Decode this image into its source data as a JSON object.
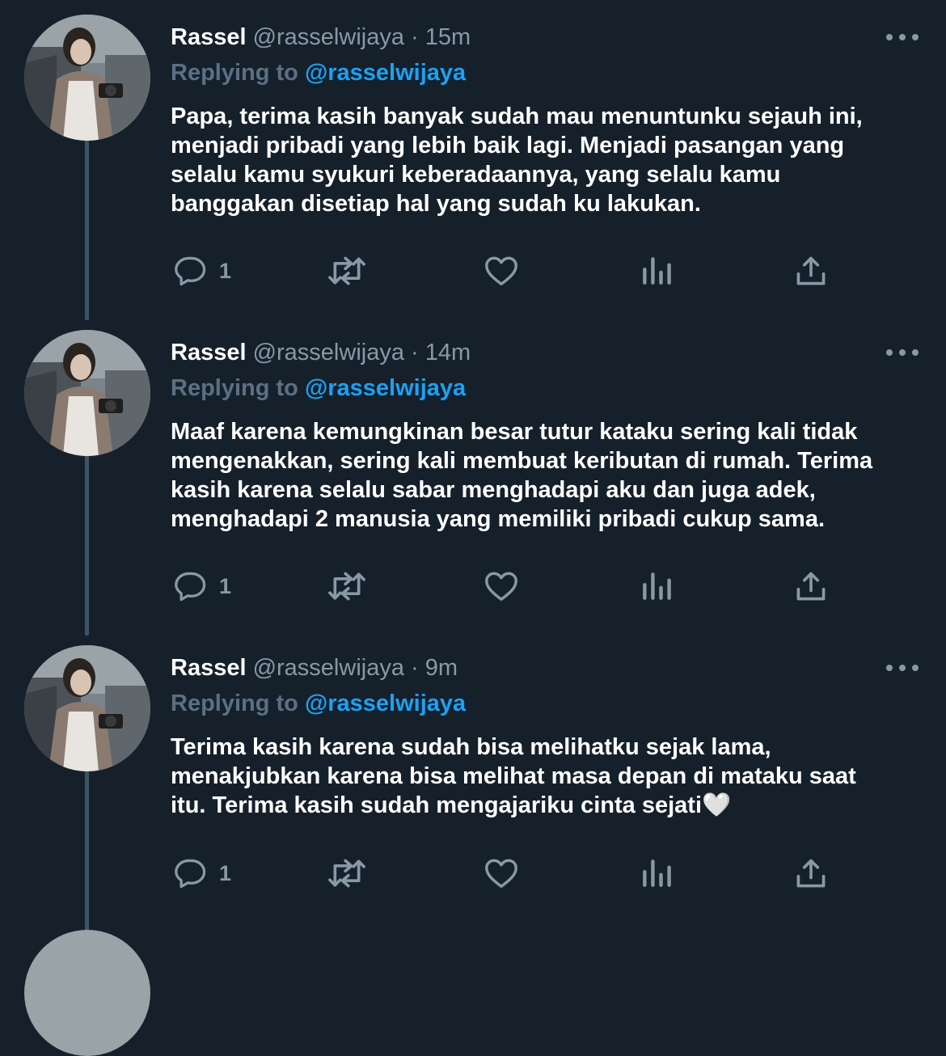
{
  "tweets": [
    {
      "name": "Rassel",
      "handle": "@rasselwijaya",
      "separator": "·",
      "time": "15m",
      "replying_prefix": "Replying to",
      "replying_to": "@rasselwijaya",
      "text": "Papa, terima kasih banyak sudah mau menuntunku sejauh ini,\nmenjadi pribadi yang lebih baik lagi. Menjadi pasangan yang\nselalu kamu syukuri keberadaannya, yang selalu kamu\nbanggakan disetiap hal yang sudah ku lakukan.",
      "reply_count": "1"
    },
    {
      "name": "Rassel",
      "handle": "@rasselwijaya",
      "separator": "·",
      "time": "14m",
      "replying_prefix": "Replying to",
      "replying_to": "@rasselwijaya",
      "text": "Maaf karena kemungkinan besar tutur kataku sering kali tidak\nmengenakkan, sering kali membuat keributan di rumah. Terima\nkasih karena selalu sabar menghadapi aku dan juga adek,\nmenghadapi 2 manusia yang memiliki pribadi cukup sama.",
      "reply_count": "1"
    },
    {
      "name": "Rassel",
      "handle": "@rasselwijaya",
      "separator": "·",
      "time": "9m",
      "replying_prefix": "Replying to",
      "replying_to": "@rasselwijaya",
      "text": "Terima kasih karena sudah bisa melihatku sejak lama,\nmenakjubkan karena bisa melihat masa depan di mataku saat\nitu. Terima kasih sudah mengajariku cinta sejati🤍",
      "reply_count": "1"
    }
  ],
  "icons": {
    "reply": "reply-icon",
    "retweet": "retweet-icon",
    "like": "heart-icon",
    "analytics": "analytics-icon",
    "share": "share-icon",
    "more": "more-icon"
  },
  "colors": {
    "background": "#15202b",
    "secondary_text": "#8899a6",
    "link": "#1da1f2",
    "thread_line": "#3d5466"
  }
}
